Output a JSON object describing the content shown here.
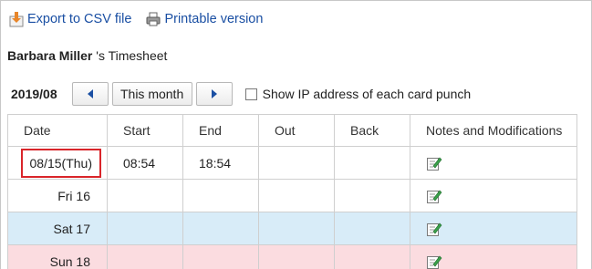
{
  "top_links": {
    "export_csv": "Export to CSV file",
    "printable": "Printable version"
  },
  "title": {
    "name": "Barbara Miller",
    "suffix": " 's Timesheet"
  },
  "nav": {
    "period": "2019/08",
    "this_month": "This month",
    "show_ip_label": "Show IP address of each card punch"
  },
  "table": {
    "headers": [
      "Date",
      "Start",
      "End",
      "Out",
      "Back",
      "Notes and Modifications"
    ],
    "rows": [
      {
        "date": "08/15(Thu)",
        "start": "08:54",
        "end": "18:54",
        "out": "",
        "back": "",
        "day_type": "weekday",
        "highlighted": true
      },
      {
        "date": "Fri 16",
        "start": "",
        "end": "",
        "out": "",
        "back": "",
        "day_type": "weekday",
        "highlighted": false
      },
      {
        "date": "Sat 17",
        "start": "",
        "end": "",
        "out": "",
        "back": "",
        "day_type": "saturday",
        "highlighted": false
      },
      {
        "date": "Sun 18",
        "start": "",
        "end": "",
        "out": "",
        "back": "",
        "day_type": "sunday",
        "highlighted": false
      }
    ]
  },
  "icons": {
    "export": "download-icon",
    "print": "printer-icon",
    "notes": "edit-note-icon"
  },
  "colors": {
    "link": "#1a4fa3",
    "saturday_bg": "#d8ecf8",
    "sunday_bg": "#fbdce0",
    "highlight_border": "#d9252a"
  }
}
